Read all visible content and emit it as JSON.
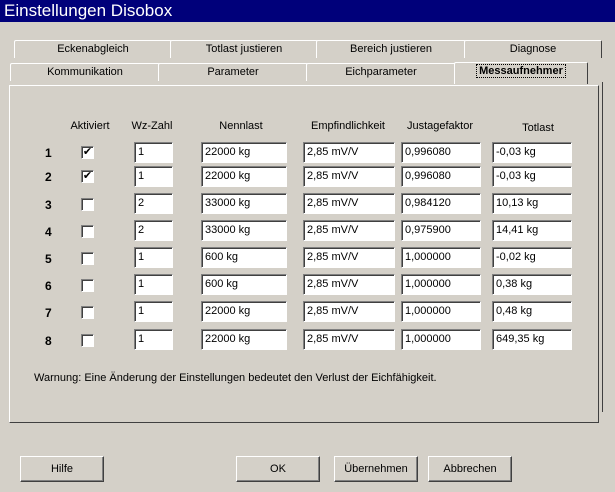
{
  "window": {
    "title": "Einstellungen Disobox"
  },
  "tabs_back": [
    "Eckenabgleich",
    "Totlast justieren",
    "Bereich justieren",
    "Diagnose"
  ],
  "tabs_front": [
    "Kommunikation",
    "Parameter",
    "Eichparameter",
    "Messaufnehmer"
  ],
  "columns": {
    "aktiviert": "Aktiviert",
    "wz": "Wz-Zahl",
    "nennlast": "Nennlast",
    "empf": "Empfindlichkeit",
    "justage": "Justagefaktor",
    "totlast": "Totlast"
  },
  "rows": [
    {
      "num": "1",
      "checked": true,
      "checkmark": "✔",
      "wz": "1",
      "nennlast": "22000 kg",
      "empf": "2,85 mV/V",
      "justage": "0,996080",
      "totlast": "-0,03 kg"
    },
    {
      "num": "2",
      "checked": true,
      "checkmark": "✔",
      "wz": "1",
      "nennlast": "22000 kg",
      "empf": "2,85 mV/V",
      "justage": "0,996080",
      "totlast": "-0,03 kg"
    },
    {
      "num": "3",
      "checked": false,
      "checkmark": "",
      "wz": "2",
      "nennlast": "33000 kg",
      "empf": "2,85 mV/V",
      "justage": "0,984120",
      "totlast": "10,13 kg"
    },
    {
      "num": "4",
      "checked": false,
      "checkmark": "",
      "wz": "2",
      "nennlast": "33000 kg",
      "empf": "2,85 mV/V",
      "justage": "0,975900",
      "totlast": "14,41 kg"
    },
    {
      "num": "5",
      "checked": false,
      "checkmark": "",
      "wz": "1",
      "nennlast": "600 kg",
      "empf": "2,85 mV/V",
      "justage": "1,000000",
      "totlast": "-0,02 kg"
    },
    {
      "num": "6",
      "checked": false,
      "checkmark": "",
      "wz": "1",
      "nennlast": "600 kg",
      "empf": "2,85 mV/V",
      "justage": "1,000000",
      "totlast": "0,38 kg"
    },
    {
      "num": "7",
      "checked": false,
      "checkmark": "",
      "wz": "1",
      "nennlast": "22000 kg",
      "empf": "2,85 mV/V",
      "justage": "1,000000",
      "totlast": "0,48 kg"
    },
    {
      "num": "8",
      "checked": false,
      "checkmark": "",
      "wz": "1",
      "nennlast": "22000 kg",
      "empf": "2,85 mV/V",
      "justage": "1,000000",
      "totlast": "649,35 kg"
    }
  ],
  "warning": "Warnung: Eine Änderung der Einstellungen bedeutet den Verlust der Eichfähigkeit.",
  "buttons": {
    "hilfe": "Hilfe",
    "ok": "OK",
    "uebernehmen": "Übernehmen",
    "abbrechen": "Abbrechen"
  }
}
